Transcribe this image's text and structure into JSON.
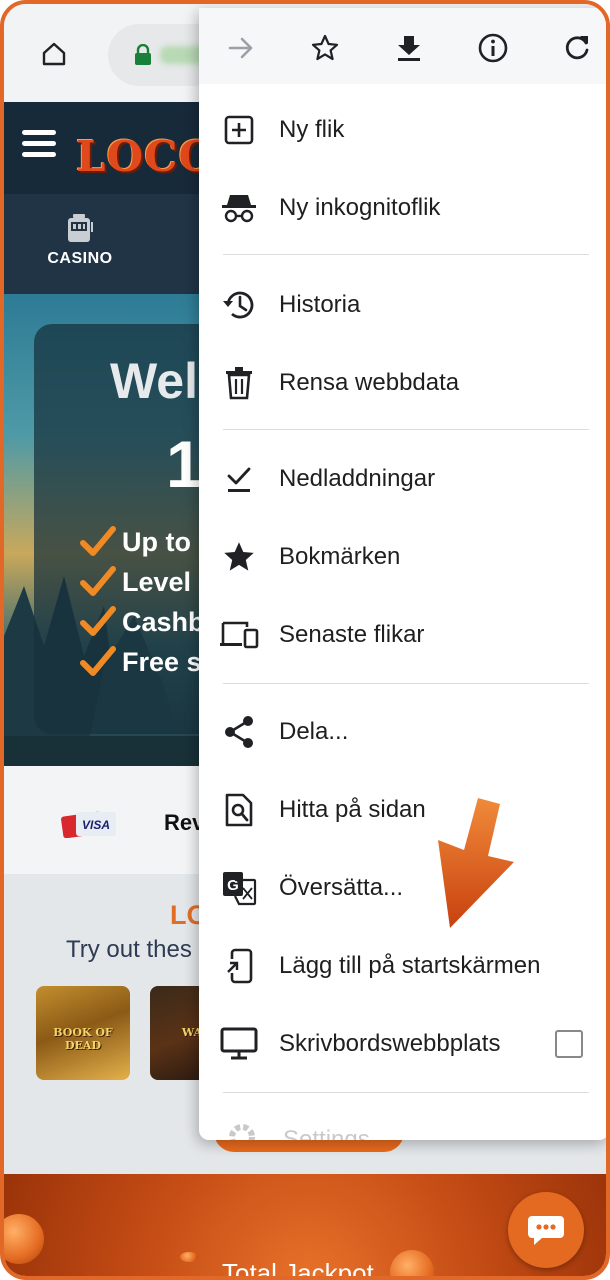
{
  "browser": {
    "url_obscured": true
  },
  "site": {
    "logo_text": "LOCO",
    "nav": {
      "casino_label": "CASINO"
    },
    "hero": {
      "title": "Wel",
      "amount": "1",
      "bullets": [
        "Up to",
        "Level",
        "Cashb",
        "Free s"
      ]
    },
    "payments": {
      "visa_label": "VISA",
      "revolut_label": "Rev"
    },
    "games": {
      "brand": "LO",
      "subtitle": "Try out thes",
      "thumb_1_label": "BOOK OF DEAD",
      "thumb_2_label": "WAN"
    },
    "jackpot": {
      "label": "Total Jackpot"
    }
  },
  "menu": {
    "toolbar": [
      "forward-icon",
      "bookmark-star-icon",
      "download-icon",
      "info-icon",
      "reload-icon"
    ],
    "items": [
      {
        "label": "Ny flik",
        "icon": "new-tab-icon"
      },
      {
        "label": "Ny inkognitoflik",
        "icon": "incognito-icon"
      },
      {
        "label": "Historia",
        "icon": "history-icon"
      },
      {
        "label": "Rensa webbdata",
        "icon": "trash-icon"
      },
      {
        "label": "Nedladdningar",
        "icon": "downloads-icon"
      },
      {
        "label": "Bokmärken",
        "icon": "bookmarks-star-icon"
      },
      {
        "label": "Senaste flikar",
        "icon": "devices-icon"
      },
      {
        "label": "Dela...",
        "icon": "share-icon"
      },
      {
        "label": "Hitta på sidan",
        "icon": "find-in-page-icon"
      },
      {
        "label": "Översätta...",
        "icon": "translate-icon"
      },
      {
        "label": "Lägg till på startskärmen",
        "icon": "add-to-homescreen-icon"
      },
      {
        "label": "Skrivbordswebbplats",
        "icon": "desktop-icon",
        "checked": false
      }
    ],
    "settings_peek": "Settings"
  },
  "colors": {
    "frame_border": "#e16827",
    "site_header": "#172a3a",
    "accent_orange": "#e46a22",
    "guide_arrow": "#e15a20",
    "menu_text": "#1f1f1f"
  }
}
